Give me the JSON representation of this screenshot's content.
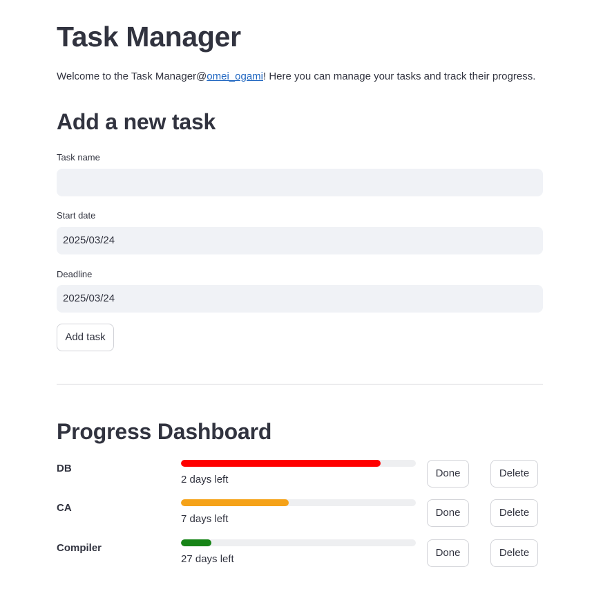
{
  "header": {
    "title": "Task Manager",
    "welcome_prefix": "Welcome to the Task Manager@",
    "welcome_link": "omei_ogami",
    "welcome_suffix": "! Here you can manage your tasks and track their progress."
  },
  "add_task": {
    "heading": "Add a new task",
    "task_name_label": "Task name",
    "task_name_value": "",
    "start_date_label": "Start date",
    "start_date_value": "2025/03/24",
    "deadline_label": "Deadline",
    "deadline_value": "2025/03/24",
    "add_button": "Add task"
  },
  "dashboard": {
    "heading": "Progress Dashboard",
    "done_label": "Done",
    "delete_label": "Delete",
    "tasks": [
      {
        "name": "DB",
        "days_left": "2 days left",
        "progress": 0.85,
        "color": "#ff0000"
      },
      {
        "name": "CA",
        "days_left": "7 days left",
        "progress": 0.46,
        "color": "#f5a218"
      },
      {
        "name": "Compiler",
        "days_left": "27 days left",
        "progress": 0.13,
        "color": "#178417"
      }
    ]
  }
}
